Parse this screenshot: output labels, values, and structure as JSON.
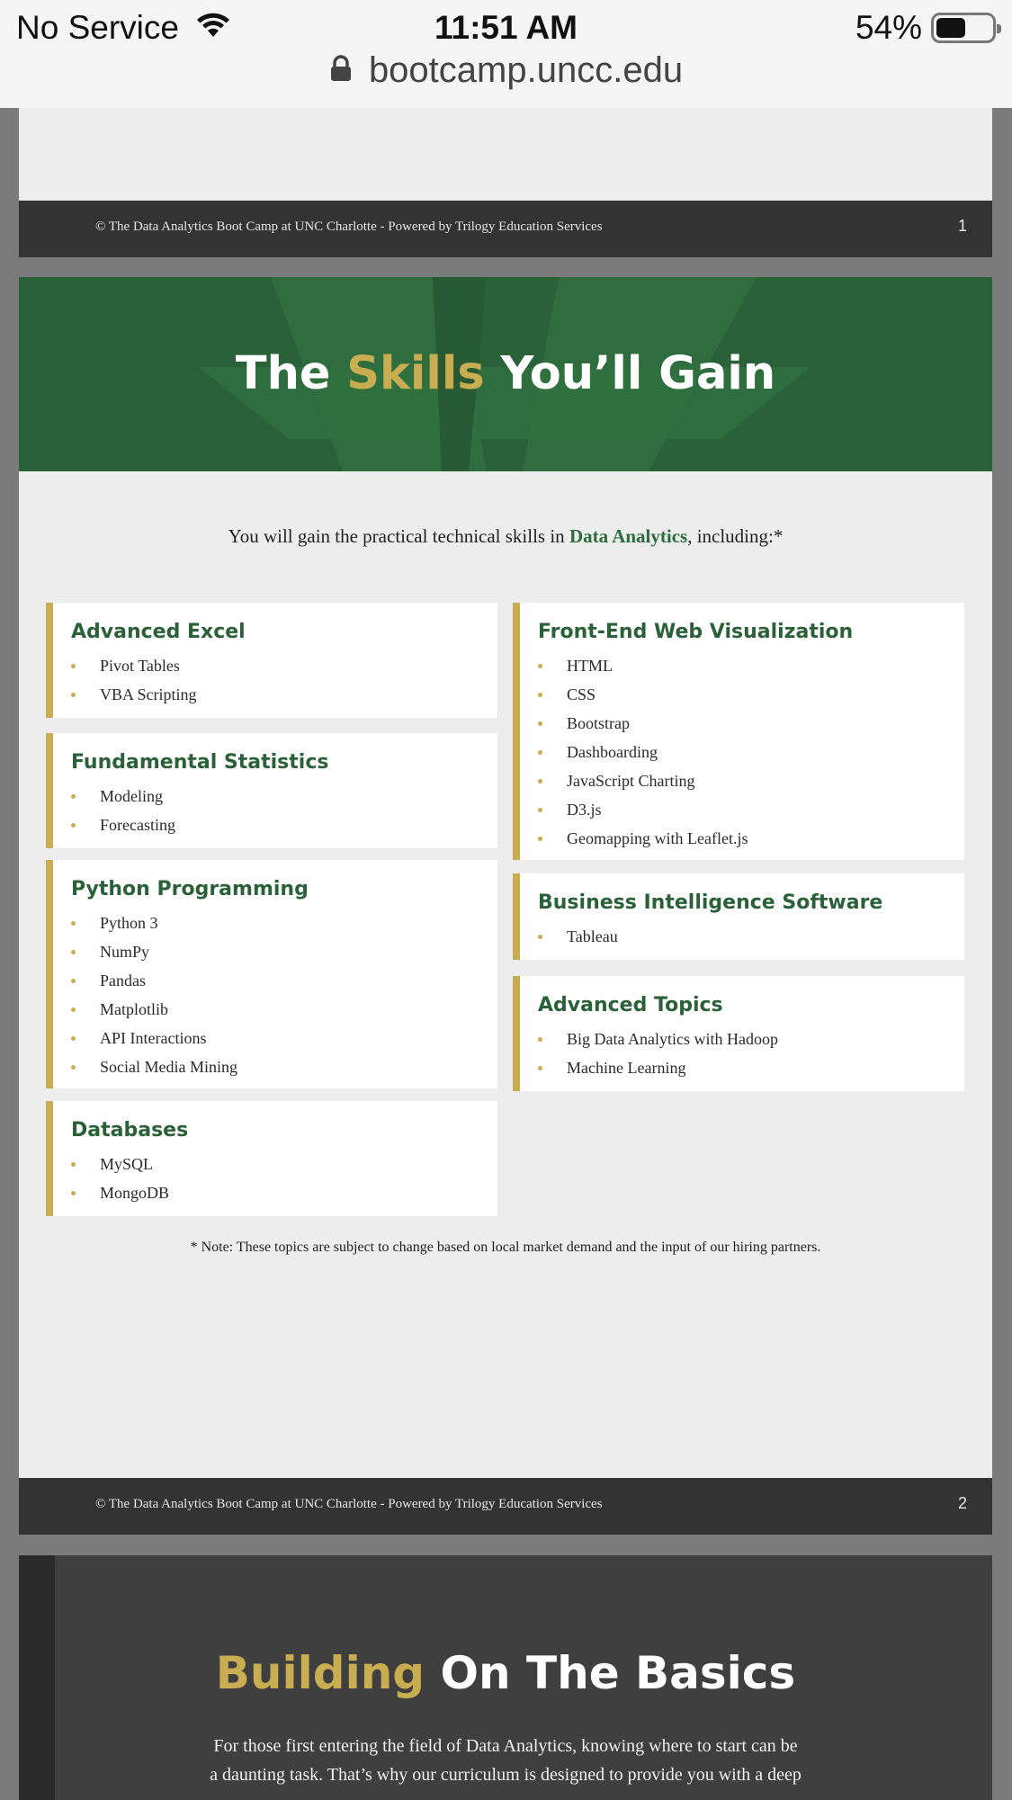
{
  "status_bar": {
    "carrier": "No Service",
    "time": "11:51 AM",
    "battery_percent": "54%",
    "battery_level": 0.54,
    "url": "bootcamp.uncc.edu"
  },
  "page1": {
    "footer_text": "© The Data Analytics Boot Camp at UNC Charlotte - Powered by Trilogy Education Services",
    "page_number": "1"
  },
  "page2": {
    "title_part1": "The ",
    "title_highlight": "Skills",
    "title_part2": " You’ll Gain",
    "intro_part1": "You will gain the practical technical skills in ",
    "intro_highlight": "Data Analytics",
    "intro_part2": ", including:*",
    "cards": [
      {
        "title": "Advanced Excel",
        "items": [
          "Pivot Tables",
          "VBA Scripting"
        ]
      },
      {
        "title": "Fundamental Statistics",
        "items": [
          "Modeling",
          "Forecasting"
        ]
      },
      {
        "title": "Python Programming",
        "items": [
          "Python 3",
          "NumPy",
          "Pandas",
          "Matplotlib",
          "API Interactions",
          "Social Media Mining"
        ]
      },
      {
        "title": "Databases",
        "items": [
          "MySQL",
          "MongoDB"
        ]
      },
      {
        "title": "Front-End Web Visualization",
        "items": [
          "HTML",
          "CSS",
          "Bootstrap",
          "Dashboarding",
          "JavaScript Charting",
          "D3.js",
          "Geomapping with Leaflet.js"
        ]
      },
      {
        "title": "Business Intelligence Software",
        "items": [
          "Tableau"
        ]
      },
      {
        "title": "Advanced Topics",
        "items": [
          "Big Data Analytics with Hadoop",
          "Machine Learning"
        ]
      }
    ],
    "note": "* Note: These topics are subject to change based on local market demand and the input of our hiring partners.",
    "footer_text": "© The Data Analytics Boot Camp at UNC Charlotte - Powered by Trilogy Education Services",
    "page_number": "2"
  },
  "page3": {
    "title_highlight": "Building",
    "title_rest": " On The Basics",
    "body_line1": "For those first entering the field of Data Analytics, knowing where to start can be",
    "body_line2": "a daunting task. That’s why our curriculum is designed to provide you with a deep"
  },
  "colors": {
    "brand_green": "#2a6138",
    "accent_gold": "#c8ad52",
    "footer_dark": "#333333"
  }
}
